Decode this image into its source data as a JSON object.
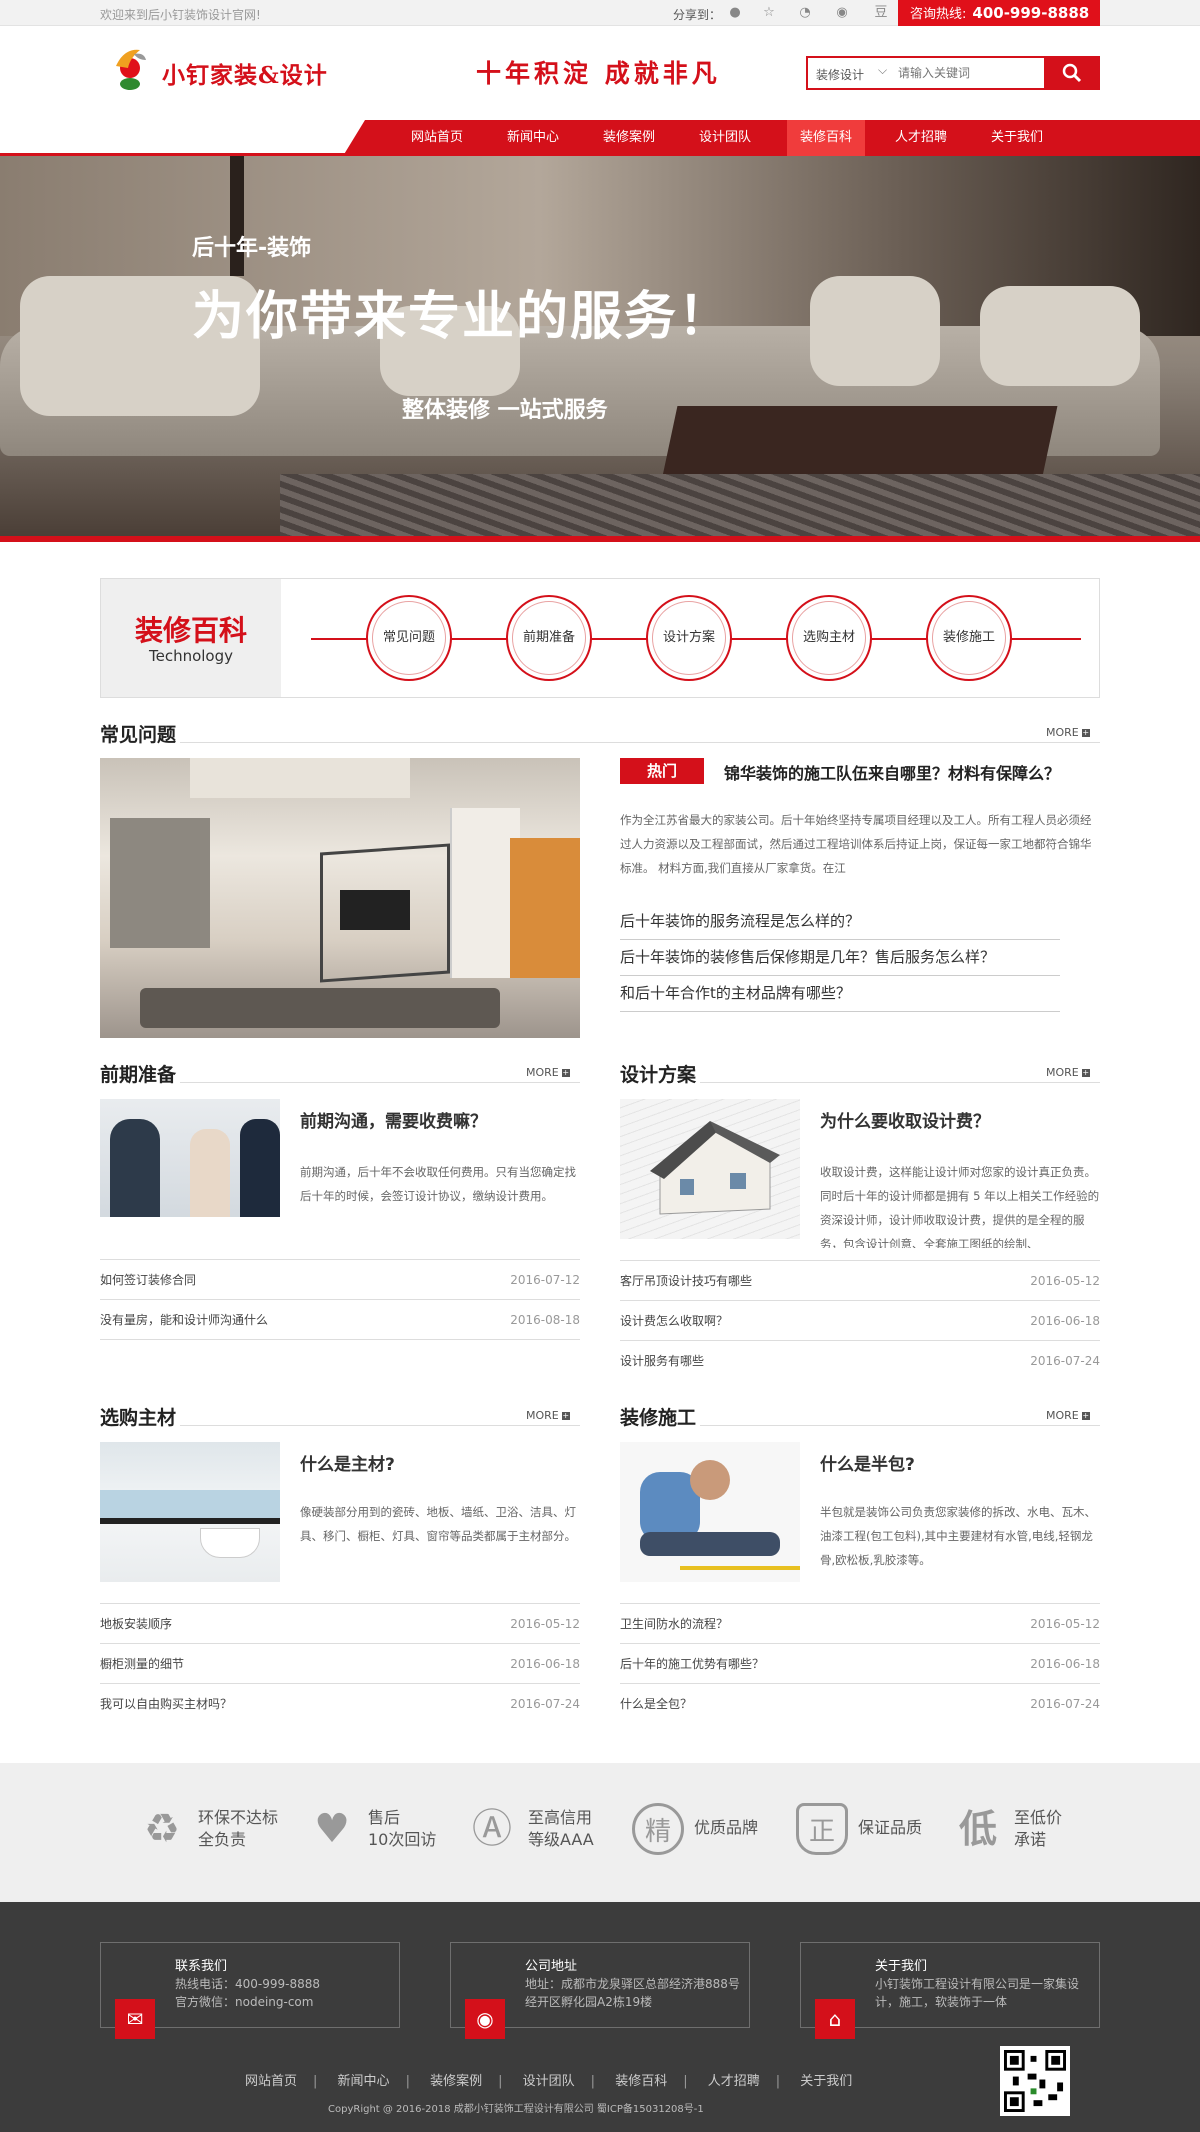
{
  "topbar": {
    "welcome": "欢迎来到后小钉装饰设计官网!",
    "share_label": "分享到：",
    "share_icons": [
      "qq-icon",
      "star-icon",
      "wechat-icon",
      "weibo-icon",
      "douban-icon"
    ],
    "douban_glyph": "豆",
    "hotline_label": "咨询热线:",
    "hotline_number": "400-999-8888"
  },
  "header": {
    "logo_text": "小钉家装&设计",
    "slogan": "十年积淀  成就非凡",
    "search": {
      "category": "装修设计",
      "placeholder": "请输入关键词"
    }
  },
  "nav": {
    "items": [
      "网站首页",
      "新闻中心",
      "装修案例",
      "设计团队",
      "装修百科",
      "人才招聘",
      "关于我们"
    ],
    "active_index": 4
  },
  "banner": {
    "line1": "后十年-装饰",
    "line2": "为你带来专业的服务！",
    "line3": "整体装修  一站式服务"
  },
  "baike": {
    "title_cn": "装修百科",
    "title_en": "Technology",
    "circles": [
      "常见问题",
      "前期准备",
      "设计方案",
      "选购主材",
      "装修施工"
    ]
  },
  "faq": {
    "title": "常见问题",
    "more": "MORE",
    "hot_tag": "热门",
    "hot_title": "锦华装饰的施工队伍来自哪里？材料有保障么？",
    "hot_desc": "作为全江苏省最大的家装公司。后十年始终坚持专属项目经理以及工人。所有工程人员必须经过人力资源以及工程部面试，然后通过工程培训体系后持证上岗，保证每一家工地都符合锦华标准。 材料方面,我们直接从厂家拿货。在江",
    "questions": [
      "后十年装饰的服务流程是怎么样的？",
      "后十年装饰的装修售后保修期是几年？售后服务怎么样？",
      "和后十年合作t的主材品牌有哪些？"
    ]
  },
  "prep": {
    "title": "前期准备",
    "more": "MORE",
    "card_title": "前期沟通，需要收费嘛？",
    "card_desc": "前期沟通，后十年不会收取任何费用。只有当您确定找后十年的时候，会签订设计协议，缴纳设计费用。",
    "rows": [
      {
        "text": "如何签订装修合同",
        "date": "2016-07-12"
      },
      {
        "text": "没有量房，能和设计师沟通什么",
        "date": "2016-08-18"
      }
    ]
  },
  "design": {
    "title": "设计方案",
    "more": "MORE",
    "card_title": "为什么要收取设计费？",
    "card_desc": "收取设计费，这样能让设计师对您家的设计真正负责。 同时后十年的设计师都是拥有 5 年以上相关工作经验的资深设计师，设计师收取设计费，提供的是全程的服务，包含设计创意、全套施工图纸的绘制、",
    "rows": [
      {
        "text": "客厅吊顶设计技巧有哪些",
        "date": "2016-05-12"
      },
      {
        "text": "设计费怎么收取啊？",
        "date": "2016-06-18"
      },
      {
        "text": "设计服务有哪些",
        "date": "2016-07-24"
      }
    ]
  },
  "material": {
    "title": "选购主材",
    "more": "MORE",
    "card_title": "什么是主材?",
    "card_desc": "像硬装部分用到的瓷砖、地板、墙纸、卫浴、洁具、灯具、移门、橱柜、灯具、窗帘等品类都属于主材部分。",
    "rows": [
      {
        "text": "地板安装顺序",
        "date": "2016-05-12"
      },
      {
        "text": "橱柜测量的细节",
        "date": "2016-06-18"
      },
      {
        "text": "我可以自由购买主材吗？",
        "date": "2016-07-24"
      }
    ]
  },
  "construction": {
    "title": "装修施工",
    "more": "MORE",
    "card_title": "什么是半包?",
    "card_desc": "半包就是装饰公司负责您家装修的拆改、水电、瓦木、油漆工程(包工包料),其中主要建材有水管,电线,轻钢龙骨,欧松板,乳胶漆等。",
    "rows": [
      {
        "text": "卫生间防水的流程？",
        "date": "2016-05-12"
      },
      {
        "text": "后十年的施工优势有哪些？",
        "date": "2016-06-18"
      },
      {
        "text": "什么是全包？",
        "date": "2016-07-24"
      }
    ]
  },
  "features": [
    {
      "icon": "recycle-icon",
      "glyph": "♻",
      "line1": "环保不达标",
      "line2": "全负责"
    },
    {
      "icon": "heart-icon",
      "glyph": "♥",
      "line1": "售后",
      "line2": "10次回访"
    },
    {
      "icon": "medal-icon",
      "glyph": "Ⓐ",
      "line1": "至高信用",
      "line2": "等级AAA"
    },
    {
      "icon": "quality-seal-icon",
      "glyph": "精",
      "line1": "优质品牌",
      "line2": ""
    },
    {
      "icon": "shield-icon",
      "glyph": "正",
      "line1": "保证品质",
      "line2": ""
    },
    {
      "icon": "low-price-icon",
      "glyph": "低",
      "line1": "至低价",
      "line2": "承诺"
    }
  ],
  "footer": {
    "contact": {
      "title": "联系我们",
      "line1": "热线电话：400-999-8888",
      "line2": "官方微信：nodeing-com"
    },
    "address": {
      "title": "公司地址",
      "text": "地址：成都市龙泉驿区总部经济港888号经开区孵化园A2栋19楼"
    },
    "about": {
      "title": "关于我们",
      "text": "小钉装饰工程设计有限公司是一家集设计，施工，软装饰于一体"
    },
    "links": [
      "网站首页",
      "新闻中心",
      "装修案例",
      "设计团队",
      "装修百科",
      "人才招聘",
      "关于我们"
    ],
    "separator": "|",
    "copyright": "CopyRight @ 2016-2018 成都小钉装饰工程设计有限公司 蜀ICP备15031208号-1"
  },
  "colors": {
    "brand_red": "#d4101a",
    "footer_bg": "#3c3c3c",
    "feature_bg": "#efefef"
  }
}
